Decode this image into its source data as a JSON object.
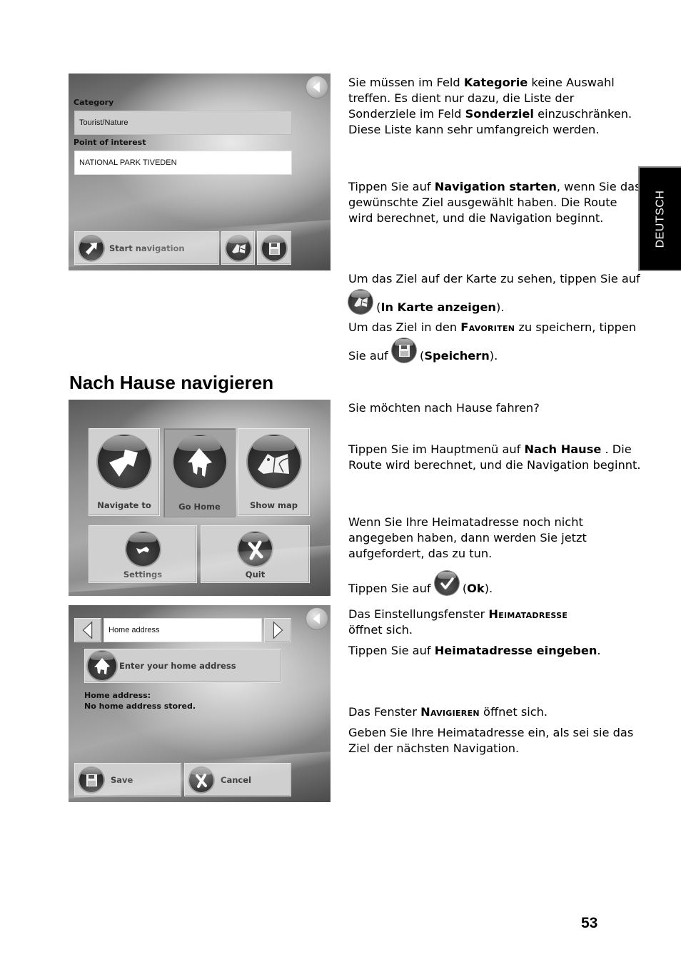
{
  "side_tab": {
    "label": "DEUTSCH"
  },
  "page_number": "53",
  "section_heading": "Nach Hause navigieren",
  "screenshot_poi": {
    "back_icon": "back-arrow-icon",
    "category_label": "Category",
    "category_value": "Tourist/Nature",
    "poi_label": "Point of interest",
    "poi_value": "NATIONAL PARK TIVEDEN",
    "start_navigation_label": "Start navigation",
    "start_navigation_icon": "navigate-arrow-icon",
    "show_map_icon": "map-icon",
    "save_icon": "floppy-disk-icon"
  },
  "screenshot_main_menu": {
    "tiles": [
      {
        "label": "Navigate to",
        "icon": "navigate-arrow-icon",
        "pressed": false
      },
      {
        "label": "Go Home",
        "icon": "house-icon",
        "pressed": true
      },
      {
        "label": "Show map",
        "icon": "map-icon",
        "pressed": false
      },
      {
        "label": "Settings",
        "icon": "wrench-icon",
        "pressed": false
      },
      {
        "label": "Quit",
        "icon": "x-cross-icon",
        "pressed": false
      }
    ]
  },
  "screenshot_home_address": {
    "prev_icon": "chevron-left-icon",
    "next_icon": "chevron-right-icon",
    "back_icon": "back-arrow-icon",
    "selector_value": "Home address",
    "enter_button_label": "Enter your home address",
    "status_line_1": "Home address:",
    "status_line_2": "No home address stored.",
    "save_label": "Save",
    "cancel_label": "Cancel"
  },
  "text": {
    "p1": {
      "t1": "Sie müssen im Feld ",
      "b1": "Kategorie",
      "t2": " keine Auswahl treffen. Es dient nur dazu, die Liste der Sonderziele im Feld ",
      "b2": "Sonderziel",
      "t3": " einzuschränken. Diese Liste kann sehr umfangreich werden."
    },
    "p2": {
      "t1": "Tippen Sie auf ",
      "b1": "Navigation starten",
      "t2": ", wenn Sie das gewünschte Ziel ausgewählt haben. Die Route wird berechnet, und die Navigation beginnt."
    },
    "p3": {
      "t1": "Um das Ziel auf der Karte zu sehen, tippen Sie auf ",
      "icon": "map-icon",
      "t2": " (",
      "b1": "In Karte anzeigen",
      "t3": ")."
    },
    "p4": {
      "t1": "Um das Ziel in den ",
      "sc1": "Favoriten",
      "t2": " zu speichern, tippen Sie auf ",
      "icon": "floppy-disk-icon",
      "t3": " (",
      "b1": "Speichern",
      "t4": ")."
    },
    "p5": {
      "t1": "Sie möchten nach Hause fahren?"
    },
    "p6": {
      "t1": "Tippen Sie im Hauptmenü auf ",
      "b1": "Nach Hause",
      "t2": " . Die Route wird berechnet, und die Navigation beginnt."
    },
    "p7": {
      "t1": "Wenn Sie Ihre Heimatadresse noch nicht angegeben haben, dann werden Sie jetzt aufgefordert, das zu tun."
    },
    "p8": {
      "t1": "Tippen Sie auf ",
      "icon": "checkmark-icon",
      "t2": " (",
      "b1": "Ok",
      "t3": ")."
    },
    "p9": {
      "t1": "Das Einstellungsfenster ",
      "sc1": "Heimatadresse",
      "t2": " öffnet sich."
    },
    "p10": {
      "t1": "Tippen Sie auf ",
      "b1": "Heimatadresse eingeben",
      "t2": "."
    },
    "p11": {
      "t1": "Das Fenster ",
      "sc1": "Navigieren",
      "t2": " öffnet sich."
    },
    "p12": {
      "t1": "Geben Sie Ihre Heimatadresse ein, als sei sie das Ziel der nächsten Navigation."
    }
  }
}
